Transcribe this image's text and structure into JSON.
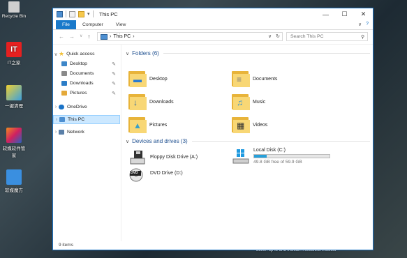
{
  "desktop": {
    "icons": [
      {
        "label": "Recycle Bin",
        "color": "#d0d0d0"
      },
      {
        "label": "IT之家",
        "color": "#e62020"
      },
      {
        "label": "一键清理",
        "color": "#3aa0e0"
      },
      {
        "label": "软媒软件管家",
        "color": "#e05020"
      },
      {
        "label": "软媒魔方",
        "color": "#3a8fe0"
      }
    ],
    "bottom_text": "action up to and includiri includiciia includiu"
  },
  "window": {
    "title": "This PC",
    "controls": {
      "minimize": "—",
      "maximize": "☐",
      "close": "✕"
    },
    "ribbon_tabs": [
      "File",
      "Computer",
      "View"
    ],
    "ribbon_expand": "∨",
    "help": "?",
    "nav": {
      "back": "←",
      "forward": "→",
      "recent": "∨",
      "up": "↑"
    },
    "address": {
      "segment": "This PC",
      "sep": "›",
      "dropdown": "∨",
      "refresh": "↻"
    },
    "search": {
      "placeholder": "Search This PC",
      "icon": "⚲"
    },
    "status": "9 items"
  },
  "nav_pane": {
    "items": [
      {
        "label": "Quick access",
        "chevron": "∨",
        "color": "#f2c037",
        "pin": ""
      },
      {
        "label": "Desktop",
        "chevron": "",
        "color": "#3d86c8",
        "pin": "✎"
      },
      {
        "label": "Documents",
        "chevron": "",
        "color": "#8a8a8a",
        "pin": "✎"
      },
      {
        "label": "Downloads",
        "chevron": "",
        "color": "#2c7dc7",
        "pin": "✎"
      },
      {
        "label": "Pictures",
        "chevron": "",
        "color": "#e4a93a",
        "pin": "✎"
      },
      {
        "label": "OneDrive",
        "chevron": "›",
        "color": "#1a73c8",
        "pin": ""
      },
      {
        "label": "This PC",
        "chevron": "›",
        "color": "#4d8fd1",
        "pin": ""
      },
      {
        "label": "Network",
        "chevron": "›",
        "color": "#5a7fa8",
        "pin": ""
      }
    ],
    "selected_index": 6
  },
  "content": {
    "folders_header": "Folders (6)",
    "folders": [
      {
        "label": "Desktop",
        "glyph": "▬",
        "glyph_color": "#2a7bd0"
      },
      {
        "label": "Documents",
        "glyph": "≡",
        "glyph_color": "#777777"
      },
      {
        "label": "Downloads",
        "glyph": "↓",
        "glyph_color": "#1b5fa8"
      },
      {
        "label": "Music",
        "glyph": "♫",
        "glyph_color": "#2a8fd6"
      },
      {
        "label": "Pictures",
        "glyph": "▲",
        "glyph_color": "#3aa0c8"
      },
      {
        "label": "Videos",
        "glyph": "▦",
        "glyph_color": "#333333"
      }
    ],
    "drives_header": "Devices and drives (3)",
    "drives": [
      {
        "label": "Floppy Disk Drive (A:)",
        "kind": "floppy-drive-icon"
      },
      {
        "label": "Local Disk (C:)",
        "kind": "windows-drive-icon",
        "free": "49.8 GB free of 59.9 GB",
        "used_fraction": 0.17
      },
      {
        "label": "DVD Drive (D:)",
        "kind": "dvd-drive-icon",
        "badge": "DVD"
      }
    ]
  }
}
